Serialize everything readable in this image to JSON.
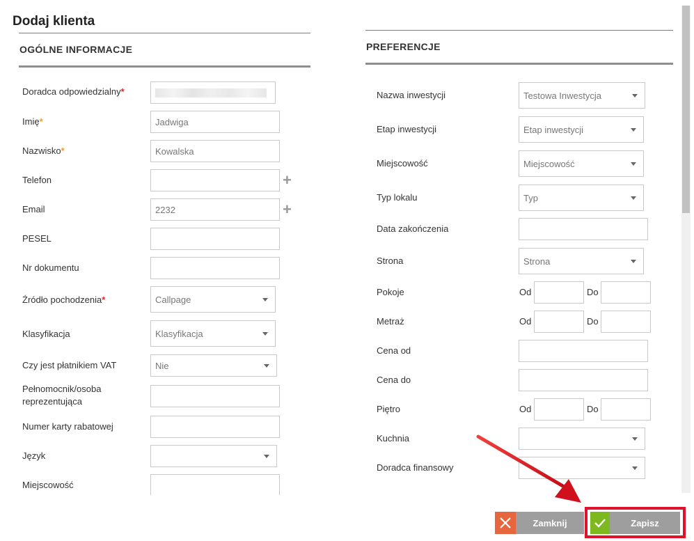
{
  "title": "Dodaj klienta",
  "left": {
    "section_title": "OGÓLNE INFORMACJE",
    "fields": {
      "advisor": {
        "label": "Doradca odpowiedzialny",
        "required": "*"
      },
      "first_name": {
        "label": "Imię",
        "required": "*",
        "value": "Jadwiga"
      },
      "last_name": {
        "label": "Nazwisko",
        "required": "*",
        "value": "Kowalska"
      },
      "phone": {
        "label": "Telefon",
        "add": "+"
      },
      "email": {
        "label": "Email",
        "value": "2232",
        "add": "+"
      },
      "pesel": {
        "label": "PESEL"
      },
      "doc_no": {
        "label": "Nr dokumentu"
      },
      "source": {
        "label": "Źródło pochodzenia",
        "required": "*",
        "value": "Callpage"
      },
      "classification": {
        "label": "Klasyfikacja",
        "value": "Klasyfikacja"
      },
      "vat": {
        "label": "Czy jest płatnikiem VAT",
        "value": "Nie"
      },
      "proxy": {
        "label_line1": "Pełnomocnik/osoba",
        "label_line2": "reprezentująca"
      },
      "discount_card": {
        "label": "Numer karty rabatowej"
      },
      "language": {
        "label": "Język"
      },
      "city": {
        "label": "Miejscowość"
      }
    }
  },
  "right": {
    "section_title": "PREFERENCJE",
    "fields": {
      "investment": {
        "label": "Nazwa inwestycji",
        "value": "Testowa Inwestycja"
      },
      "stage": {
        "label": "Etap inwestycji",
        "value": "Etap inwestycji"
      },
      "city": {
        "label": "Miejscowość",
        "value": "Miejscowość"
      },
      "unit_type": {
        "label": "Typ lokalu",
        "value": "Typ"
      },
      "completion": {
        "label": "Data zakończenia"
      },
      "side": {
        "label": "Strona",
        "value": "Strona"
      },
      "rooms": {
        "label": "Pokoje"
      },
      "area": {
        "label": "Metraż"
      },
      "price_from": {
        "label": "Cena od"
      },
      "price_to": {
        "label": "Cena do"
      },
      "floor": {
        "label": "Piętro"
      },
      "kitchen": {
        "label": "Kuchnia"
      },
      "fin_advisor": {
        "label": "Doradca finansowy"
      }
    },
    "range_from": "Od",
    "range_to": "Do"
  },
  "buttons": {
    "close": "Zamknij",
    "save": "Zapisz"
  },
  "colors": {
    "required": "#e0212b",
    "required_alt": "#f0a020",
    "close_icon_bg": "#e8663d",
    "save_icon_bg": "#7cb81e",
    "highlight": "#e0112a",
    "arrow": "#d8101e"
  },
  "icons": [
    "x-icon",
    "check-icon",
    "plus-icon",
    "caret-down-icon",
    "red-arrow-annotation"
  ]
}
